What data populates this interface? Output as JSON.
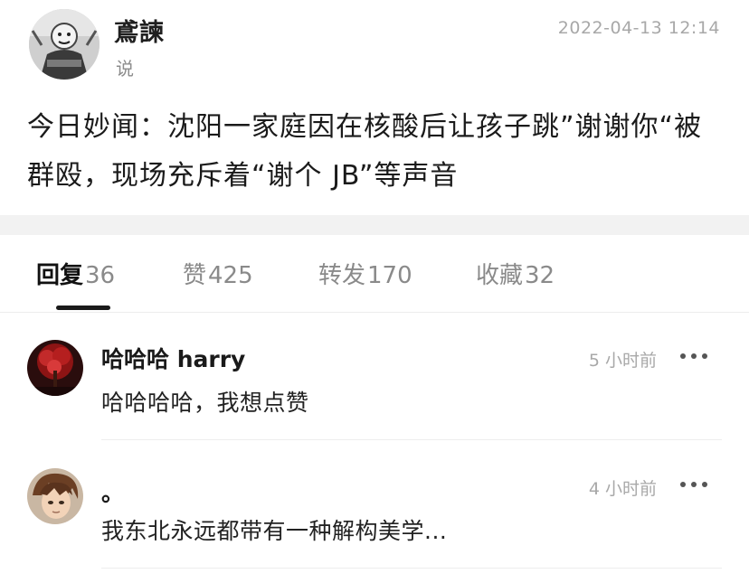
{
  "post": {
    "author_name": "鳶諫",
    "author_sub": "说",
    "timestamp": "2022-04-13 12:14",
    "body": "今日妙闻：沈阳一家庭因在核酸后让孩子跳”谢谢你“被群殴，现场充斥着“谢个 JB”等声音"
  },
  "tabs": [
    {
      "label": "回复",
      "count": "36",
      "active": true
    },
    {
      "label": "赞",
      "count": "425",
      "active": false
    },
    {
      "label": "转发",
      "count": "170",
      "active": false
    },
    {
      "label": "收藏",
      "count": "32",
      "active": false
    }
  ],
  "comments": [
    {
      "name": "哈哈哈 harry",
      "time": "5 小时前",
      "text": "哈哈哈哈，我想点赞",
      "avatar": "red-tree-avatar-icon"
    },
    {
      "name": "。",
      "time": "4 小时前",
      "text": "我东北永远都带有一种解构美学...",
      "avatar": "anime-character-avatar-icon"
    }
  ],
  "icons": {
    "author_avatar": "masked-figure-avatar-icon",
    "more": "more-dots-icon"
  },
  "colors": {
    "text_primary": "#1a1a1a",
    "text_secondary": "#8a8a8a",
    "divider": "#f2f2f2"
  }
}
